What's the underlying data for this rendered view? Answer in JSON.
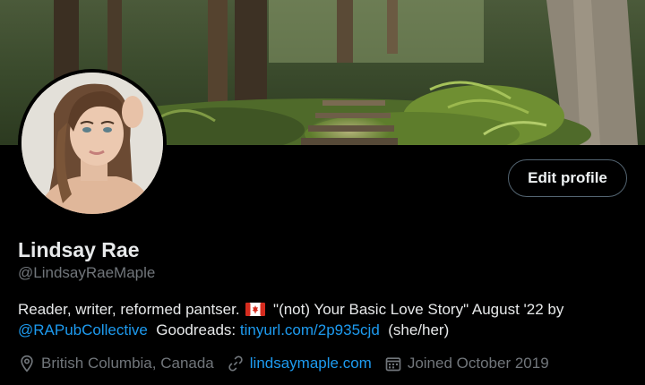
{
  "profile": {
    "name": "Lindsay Rae",
    "handle": "@LindsayRaeMaple",
    "edit_label": "Edit profile",
    "bio": {
      "part1": "Reader, writer, reformed pantser.",
      "flag_icon": "canada-flag-icon",
      "part2": "\"(not) Your Basic Love Story\" August '22 by",
      "mention": "@RAPubCollective",
      "part3": "Goodreads:",
      "goodreads_link": "tinyurl.com/2p935cjd",
      "pronouns": "(she/her)"
    },
    "meta": {
      "location": "British Columbia, Canada",
      "website": "lindsaymaple.com",
      "joined": "Joined October 2019"
    },
    "icons": {
      "location": "location-pin-icon",
      "website": "link-icon",
      "joined": "calendar-icon"
    }
  },
  "colors": {
    "background": "#000000",
    "text": "#e7e9ea",
    "secondary": "#71767b",
    "accent": "#1d9bf0",
    "button_border": "#536471"
  }
}
